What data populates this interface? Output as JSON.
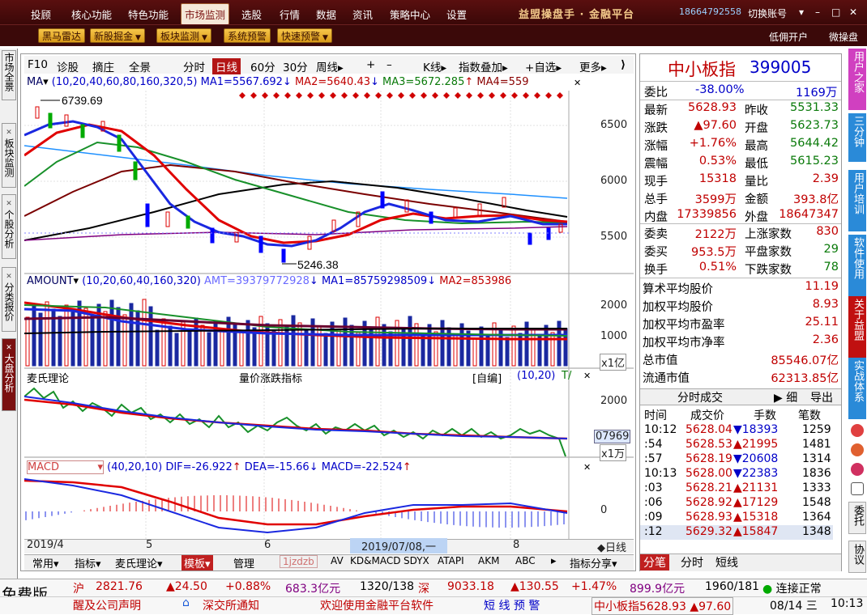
{
  "topbar": {
    "menu": [
      "投顾",
      "核心功能",
      "特色功能",
      "市场监测",
      "选股",
      "行情",
      "数据",
      "资讯",
      "策略中心",
      "设置"
    ],
    "active_index": 3,
    "brand": "益盟操盘手 · 金融平台",
    "phone": "18664792558",
    "account": "切换账号"
  },
  "toolbar2": {
    "buttons": [
      "黑马雷达",
      "新股掘金",
      "板块监测",
      "系统预警",
      "快速预警"
    ],
    "low_open": "低佣开户",
    "weicao": "微操盘"
  },
  "left_tabs": [
    "市场全景",
    "板块监测",
    "个股分析",
    "分类报价",
    "大盘分析"
  ],
  "right_tabs": [
    "用户之家",
    "三分钟",
    "用户培训",
    "软件使用",
    "关于益盟",
    "实战体系",
    "委托",
    "协议"
  ],
  "chart_toolbar": {
    "items": [
      "F10",
      "诊股",
      "摘庄",
      "全景",
      "分时",
      "日线",
      "60分",
      "30分",
      "周线",
      "K线",
      "指数叠加",
      "自选",
      "更多"
    ],
    "active": "日线"
  },
  "price_pane": {
    "header": [
      "MA",
      "(10,20,40,60,80,160,320,5)",
      "MA1=5567.692",
      "MA2=5640.43",
      "MA3=5672.285",
      "MA4=559"
    ],
    "high_label": "6739.69",
    "low_label": "5246.38",
    "yticks": [
      "6500",
      "6000",
      "5500"
    ]
  },
  "amount_pane": {
    "header": [
      "AMOUNT",
      "(10,20,60,40,160,320)",
      "AMT=39379772928",
      "MA1=85759298509",
      "MA2=853986"
    ],
    "yticks": [
      "2000",
      "1000"
    ],
    "unit": "x1亿"
  },
  "mai_pane": {
    "title": "麦氏理论",
    "subtitle": "量价涨跌指标",
    "mode": "[自编]",
    "params": "(10,20)",
    "yticks": [
      "2000"
    ],
    "value_box": "07969",
    "unit": "x1万"
  },
  "macd_pane": {
    "name": "MACD",
    "params": "(40,20,10)",
    "dif": "DIF=-26.922",
    "dea": "DEA=-15.66",
    "macd": "MACD=-22.524",
    "yticks": [
      "0"
    ]
  },
  "dates": [
    "2019/4",
    "5",
    "6",
    "2019/07/08,一",
    "8"
  ],
  "period_label": "◆日线",
  "bottom_tabs": [
    "常用",
    "指标",
    "麦氏理论",
    "模板",
    "管理",
    "1jzdzb",
    "AV",
    "KD&MACD",
    "SDYX",
    "ATAPI",
    "AKM",
    "ABC",
    "指标分享"
  ],
  "info": {
    "name": "中小板指",
    "code": "399005",
    "weibi_label": "委比",
    "weibi": "-38.00%",
    "weicha": "1169万",
    "rows": [
      [
        "最新",
        "5628.93",
        "昨收",
        "5531.33"
      ],
      [
        "涨跌",
        "▲97.60",
        "开盘",
        "5623.73"
      ],
      [
        "涨幅",
        "+1.76%",
        "最高",
        "5644.42"
      ],
      [
        "震幅",
        "0.53%",
        "最低",
        "5615.23"
      ],
      [
        "现手",
        "15318",
        "量比",
        "2.39"
      ],
      [
        "总手",
        "3599万",
        "金额",
        "393.8亿"
      ],
      [
        "内盘",
        "17339856",
        "外盘",
        "18647347"
      ]
    ],
    "rows2": [
      [
        "委卖",
        "2122万",
        "上涨家数",
        "830"
      ],
      [
        "委买",
        "953.5万",
        "平盘家数",
        "29"
      ],
      [
        "换手",
        "0.51%",
        "下跌家数",
        "78"
      ]
    ],
    "stats": [
      [
        "算术平均股价",
        "11.19"
      ],
      [
        "加权平均股价",
        "8.93"
      ],
      [
        "加权平均市盈率",
        "25.11"
      ],
      [
        "加权平均市净率",
        "2.36"
      ],
      [
        "总市值",
        "85546.07亿"
      ],
      [
        "流通市值",
        "62313.85亿"
      ]
    ],
    "ticks_title": "分时成交",
    "ticks_btn1": "细",
    "ticks_btn2": "导出",
    "ticks_headers": [
      "时间",
      "成交价",
      "手数",
      "笔数"
    ],
    "ticks": [
      [
        "10:12",
        "5628.04",
        "▼18393",
        "1259"
      ],
      [
        ":54",
        "5628.53",
        "▲21995",
        "1481"
      ],
      [
        ":57",
        "5628.19",
        "▼20608",
        "1314"
      ],
      [
        "10:13",
        "5628.00",
        "▼22383",
        "1836"
      ],
      [
        ":03",
        "5628.21",
        "▲21131",
        "1333"
      ],
      [
        ":06",
        "5628.92",
        "▲17129",
        "1548"
      ],
      [
        ":09",
        "5628.93",
        "▲15318",
        "1364"
      ],
      [
        ":12",
        "5629.32",
        "▲15847",
        "1348"
      ]
    ],
    "bottom_tabs": [
      "分笔",
      "分时",
      "短线"
    ]
  },
  "ticker": {
    "free": "免费版",
    "sh_label": "沪",
    "sh_price": "2821.76",
    "sh_chg": "▲24.50",
    "sh_pct": "+0.88%",
    "sh_amt": "683.3亿元",
    "sh_ud": "1320/138",
    "sz_label": "深",
    "sz_price": "9033.18",
    "sz_chg": "▲130.55",
    "sz_pct": "+1.47%",
    "sz_amt": "899.9亿元",
    "sz_ud": "1960/181",
    "conn": "连接正常",
    "news1": "醒及公司声明",
    "news2": "深交所通知",
    "news3": "欢迎使用金融平台软件",
    "alert": "短 线 预 警",
    "idx": "中小板指5628.93 ▲97.60",
    "date": "08/14 三",
    "time": "10:13"
  }
}
